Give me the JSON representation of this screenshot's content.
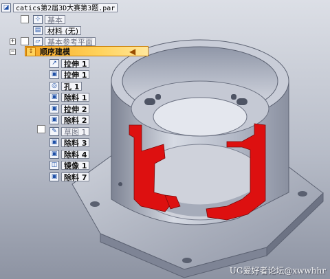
{
  "document": {
    "title": "catics第2届3D大赛第3题.par"
  },
  "tree": {
    "base": "基本",
    "material": "材料 (无)",
    "ref_planes": "基本参考平面",
    "ordered_modeling": "顺序建模",
    "features": [
      {
        "label": "拉伸 1",
        "icon": "extrude-icon",
        "glyph": "↗"
      },
      {
        "label": "拉伸 1",
        "icon": "extrude-icon",
        "glyph": "▣"
      },
      {
        "label": "孔 1",
        "icon": "hole-icon",
        "glyph": "◎"
      },
      {
        "label": "除料 1",
        "icon": "cut-icon",
        "glyph": "▣"
      },
      {
        "label": "拉伸 2",
        "icon": "extrude-icon",
        "glyph": "▣"
      },
      {
        "label": "除料 2",
        "icon": "cut-icon",
        "glyph": "▣"
      },
      {
        "label": "草图 1",
        "icon": "sketch-icon",
        "glyph": "✎"
      },
      {
        "label": "除料 3",
        "icon": "cut-icon",
        "glyph": "▣"
      },
      {
        "label": "除料 4",
        "icon": "cut-icon",
        "glyph": "▣"
      },
      {
        "label": "镜像 1",
        "icon": "mirror-icon",
        "glyph": "◫"
      },
      {
        "label": "除料 7",
        "icon": "cut-icon",
        "glyph": "▣"
      }
    ]
  },
  "watermark": "UG爱好者论坛@xwwhhr",
  "colors": {
    "section": "#dd1010",
    "body": "#c7cbd6",
    "selection": "#f7a623"
  }
}
